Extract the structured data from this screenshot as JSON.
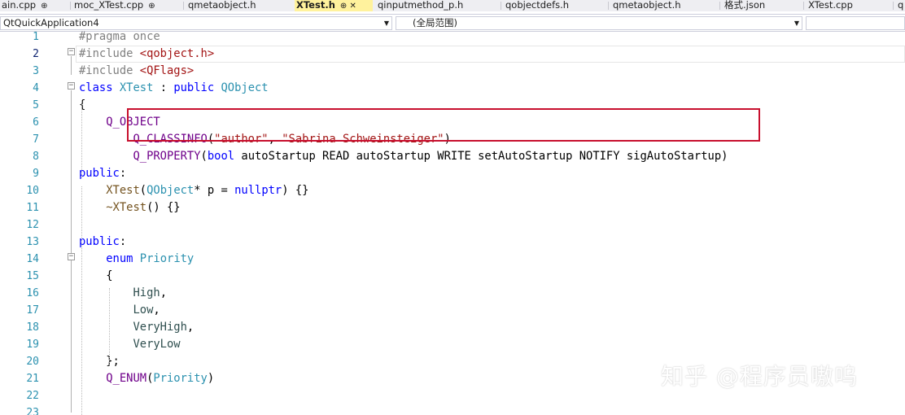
{
  "tabs": [
    {
      "label": "ain.cpp",
      "icons": "⊕",
      "active": false
    },
    {
      "label": "moc_XTest.cpp",
      "icons": "⊕",
      "active": false
    },
    {
      "label": "qmetaobject.h",
      "icons": "",
      "active": false
    },
    {
      "label": "XTest.h",
      "icons": "⊕ ✕",
      "active": true
    },
    {
      "label": "qinputmethod_p.h",
      "icons": "",
      "active": false
    },
    {
      "label": "qobjectdefs.h",
      "icons": "",
      "active": false
    },
    {
      "label": "qmetaobject.h",
      "icons": "",
      "active": false
    },
    {
      "label": "格式.json",
      "icons": "",
      "active": false
    },
    {
      "label": "XTest.cpp",
      "icons": "",
      "active": false
    },
    {
      "label": "q",
      "icons": "",
      "active": false
    }
  ],
  "navbar": {
    "project": "QtQuickApplication4",
    "scope": "(全局范围)"
  },
  "line_numbers": [
    "1",
    "2",
    "3",
    "4",
    "5",
    "6",
    "7",
    "8",
    "9",
    "10",
    "11",
    "12",
    "13",
    "14",
    "15",
    "16",
    "17",
    "18",
    "19",
    "20",
    "21",
    "22",
    "23"
  ],
  "code": [
    [
      {
        "t": "#pragma once",
        "c": "pp"
      }
    ],
    [
      {
        "t": "#include ",
        "c": "pp"
      },
      {
        "t": "<qobject.h>",
        "c": "st"
      }
    ],
    [
      {
        "t": "#include ",
        "c": "pp"
      },
      {
        "t": "<QFlags>",
        "c": "st"
      }
    ],
    [
      {
        "t": "class ",
        "c": "kw"
      },
      {
        "t": "XTest",
        "c": "ty"
      },
      {
        "t": " : ",
        "c": ""
      },
      {
        "t": "public ",
        "c": "kw"
      },
      {
        "t": "QObject",
        "c": "ty"
      }
    ],
    [
      {
        "t": "{",
        "c": ""
      }
    ],
    [
      {
        "t": "    ",
        "c": ""
      },
      {
        "t": "Q_OBJECT",
        "c": "mc"
      }
    ],
    [
      {
        "t": "        ",
        "c": ""
      },
      {
        "t": "Q_CLASSINFO",
        "c": "mc"
      },
      {
        "t": "(",
        "c": ""
      },
      {
        "t": "\"author\"",
        "c": "st"
      },
      {
        "t": ", ",
        "c": ""
      },
      {
        "t": "\"Sabrina Schweinsteiger\"",
        "c": "st"
      },
      {
        "t": ")",
        "c": ""
      }
    ],
    [
      {
        "t": "        ",
        "c": ""
      },
      {
        "t": "Q_PROPERTY",
        "c": "mc"
      },
      {
        "t": "(",
        "c": ""
      },
      {
        "t": "bool",
        "c": "kw"
      },
      {
        "t": " autoStartup READ autoStartup WRITE setAutoStartup NOTIFY sigAutoStartup)",
        "c": ""
      }
    ],
    [
      {
        "t": "public",
        "c": "kw"
      },
      {
        "t": ":",
        "c": ""
      }
    ],
    [
      {
        "t": "    ",
        "c": ""
      },
      {
        "t": "XTest",
        "c": "fn"
      },
      {
        "t": "(",
        "c": ""
      },
      {
        "t": "QObject",
        "c": "ty"
      },
      {
        "t": "* p = ",
        "c": ""
      },
      {
        "t": "nullptr",
        "c": "kw"
      },
      {
        "t": ") {}",
        "c": ""
      }
    ],
    [
      {
        "t": "    ",
        "c": ""
      },
      {
        "t": "~XTest",
        "c": "fn"
      },
      {
        "t": "() {}",
        "c": ""
      }
    ],
    [],
    [
      {
        "t": "public",
        "c": "kw"
      },
      {
        "t": ":",
        "c": ""
      }
    ],
    [
      {
        "t": "    ",
        "c": ""
      },
      {
        "t": "enum ",
        "c": "kw"
      },
      {
        "t": "Priority",
        "c": "ty"
      }
    ],
    [
      {
        "t": "    {",
        "c": ""
      }
    ],
    [
      {
        "t": "        ",
        "c": ""
      },
      {
        "t": "High",
        "c": "en"
      },
      {
        "t": ",",
        "c": ""
      }
    ],
    [
      {
        "t": "        ",
        "c": ""
      },
      {
        "t": "Low",
        "c": "en"
      },
      {
        "t": ",",
        "c": ""
      }
    ],
    [
      {
        "t": "        ",
        "c": ""
      },
      {
        "t": "VeryHigh",
        "c": "en"
      },
      {
        "t": ",",
        "c": ""
      }
    ],
    [
      {
        "t": "        ",
        "c": ""
      },
      {
        "t": "VeryLow",
        "c": "en"
      }
    ],
    [
      {
        "t": "    };",
        "c": ""
      }
    ],
    [
      {
        "t": "    ",
        "c": ""
      },
      {
        "t": "Q_ENUM",
        "c": "mc"
      },
      {
        "t": "(",
        "c": ""
      },
      {
        "t": "Priority",
        "c": "ty"
      },
      {
        "t": ")",
        "c": ""
      }
    ],
    [],
    []
  ],
  "current_line": 2,
  "watermark": "知乎 @程序员嗷呜",
  "colors": {
    "keyword": "#0000ff",
    "type": "#2b91af",
    "macro": "#6f008a",
    "string": "#a31515",
    "preprocessor": "#808080",
    "highlight_box": "#c8102e",
    "active_tab": "#fff29d"
  }
}
